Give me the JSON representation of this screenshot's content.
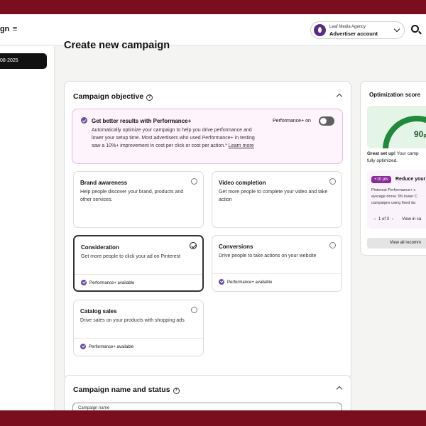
{
  "header": {
    "brand_label": "gn",
    "menu_icon": "≡",
    "account": {
      "agency": "Leaf Media Agency",
      "name": "Advertiser account"
    }
  },
  "sidebar": {
    "date_label": "08-2025"
  },
  "page": {
    "title": "Create new campaign"
  },
  "objective": {
    "title": "Campaign objective",
    "performance_banner": {
      "title": "Get better results with Performance+",
      "description": "Automatically optimize your campaign to help you drive performance and lower your setup time. Most advertisers who used Performance+ in testing saw a 10%+ improvement in cost per click or cost per action.*",
      "learn_more": "Learn more",
      "toggle_label": "Performance+ on",
      "toggle_on": false
    },
    "options": [
      {
        "title": "Brand awareness",
        "description": "Help people discover your brand, products and other services.",
        "selected": false,
        "performance": ""
      },
      {
        "title": "Video completion",
        "description": "Get more people to complete your video and take action",
        "selected": false,
        "performance": ""
      },
      {
        "title": "Consideration",
        "description": "Get more people to click your ad on Pinterest",
        "selected": true,
        "performance": "Performance+ available"
      },
      {
        "title": "Conversions",
        "description": "Drive people to take actions on your website",
        "selected": false,
        "performance": "Performance+ available"
      },
      {
        "title": "Catalog sales",
        "description": "Drive sales on your products with shopping ads",
        "selected": false,
        "performance": "Performance+ available"
      }
    ]
  },
  "optimization": {
    "title": "Optimization score",
    "score": 90,
    "score_text": "90",
    "score_suffix": "pt",
    "setup_bold": "Great set up!",
    "setup_rest": " Your camp",
    "setup_line2": "fully optimized.",
    "rec_badge": "+10 pts",
    "rec_title": "Reduce your",
    "rec_desc_1": "Pinterest Performance+ c",
    "rec_desc_2": "average drove 3% lower C",
    "rec_desc_3": "campaigns using fixed da",
    "pager": "1 of 3",
    "view_link": "View in ca",
    "view_all": "View all recomm",
    "colors": {
      "gauge": "#1f8a3c",
      "gauge_bg": "#e4f5e7"
    }
  },
  "name_status": {
    "title": "Campaign name and status",
    "input_label": "Campaign name"
  }
}
